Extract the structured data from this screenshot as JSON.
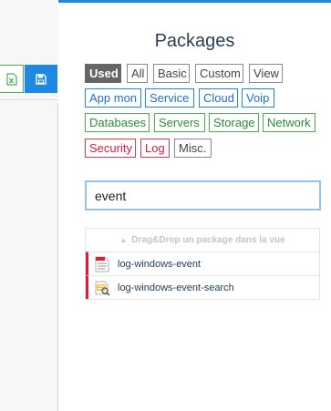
{
  "header": {
    "title": "Packages"
  },
  "toolbar": {
    "excel_icon": "excel-export-icon",
    "save_icon": "save-icon"
  },
  "filters": {
    "row1": [
      {
        "label": "Used",
        "active": true
      },
      {
        "label": "All"
      },
      {
        "label": "Basic"
      },
      {
        "label": "Custom"
      },
      {
        "label": "View"
      }
    ],
    "row2": [
      "App mon",
      "Service",
      "Cloud",
      "Voip"
    ],
    "row3": [
      "Databases",
      "Servers",
      "Storage",
      "Network"
    ],
    "row4_red": [
      "Security",
      "Log"
    ],
    "row4_misc": "Misc."
  },
  "search": {
    "value": "event"
  },
  "list": {
    "hint": "Drag&Drop un package dans la vue",
    "items": [
      {
        "label": "log-windows-event",
        "icon": "log-document-icon"
      },
      {
        "label": "log-windows-event-search",
        "icon": "log-search-icon"
      }
    ]
  },
  "colors": {
    "accent": "#1e88e5",
    "green": "#4caf50",
    "red": "#d8203a",
    "used": "#666666"
  }
}
